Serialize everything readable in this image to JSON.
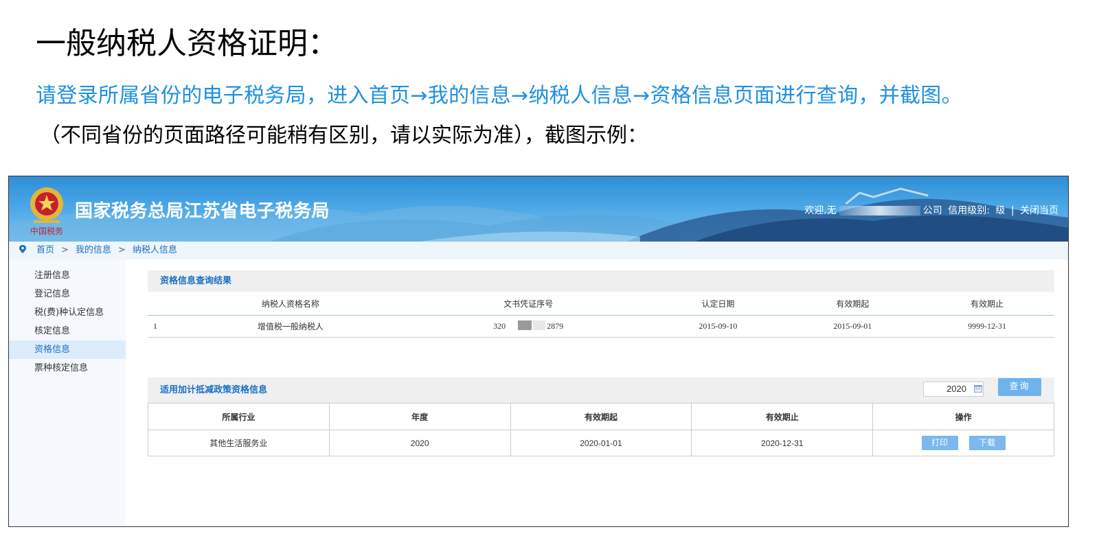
{
  "slide": {
    "title": "一般纳税人资格证明：",
    "instruction": "请登录所属省份的电子税务局，进入首页→我的信息→纳税人信息→资格信息页面进行查询，并截图。",
    "note": "（不同省份的页面路径可能稍有区别，请以实际为准），截图示例："
  },
  "header": {
    "site_title": "国家税务总局江苏省电子税务局",
    "welcome_prefix": "欢迎,无",
    "company_suffix": "公司",
    "credit_label": "信用级别:",
    "credit_value": "级",
    "divider": "|",
    "close_link": "关闭当页"
  },
  "breadcrumb": [
    "首页",
    "我的信息",
    "纳税人信息"
  ],
  "breadcrumb_sep": ">",
  "sidebar": {
    "items": [
      "注册信息",
      "登记信息",
      "税(费)种认定信息",
      "核定信息",
      "资格信息",
      "票种核定信息"
    ],
    "active_index": 4
  },
  "qualification": {
    "heading": "资格信息查询结果",
    "columns": [
      "纳税人资格名称",
      "文书凭证序号",
      "认定日期",
      "有效期起",
      "有效期止"
    ],
    "rows": [
      {
        "index": "1",
        "name": "增值税一般纳税人",
        "doc_prefix": "320",
        "doc_suffix": "2879",
        "recognized": "2015-09-10",
        "valid_from": "2015-09-01",
        "valid_to": "9999-12-31"
      }
    ]
  },
  "policy": {
    "heading": "适用加计抵减政策资格信息",
    "year_value": "2020",
    "query_button": "查询",
    "columns": [
      "所属行业",
      "年度",
      "有效期起",
      "有效期止",
      "操作"
    ],
    "rows": [
      {
        "industry": "其他生活服务业",
        "year": "2020",
        "valid_from": "2020-01-01",
        "valid_to": "2020-12-31",
        "print": "打印",
        "download": "下载"
      }
    ]
  },
  "colors": {
    "instruction_text": "#1e90e0",
    "banner": "#2f8fd6",
    "link": "#1a6fc6",
    "button": "#6fb3ec"
  },
  "icons": [
    "tax-emblem-icon",
    "location-pin-icon",
    "calendar-icon"
  ]
}
